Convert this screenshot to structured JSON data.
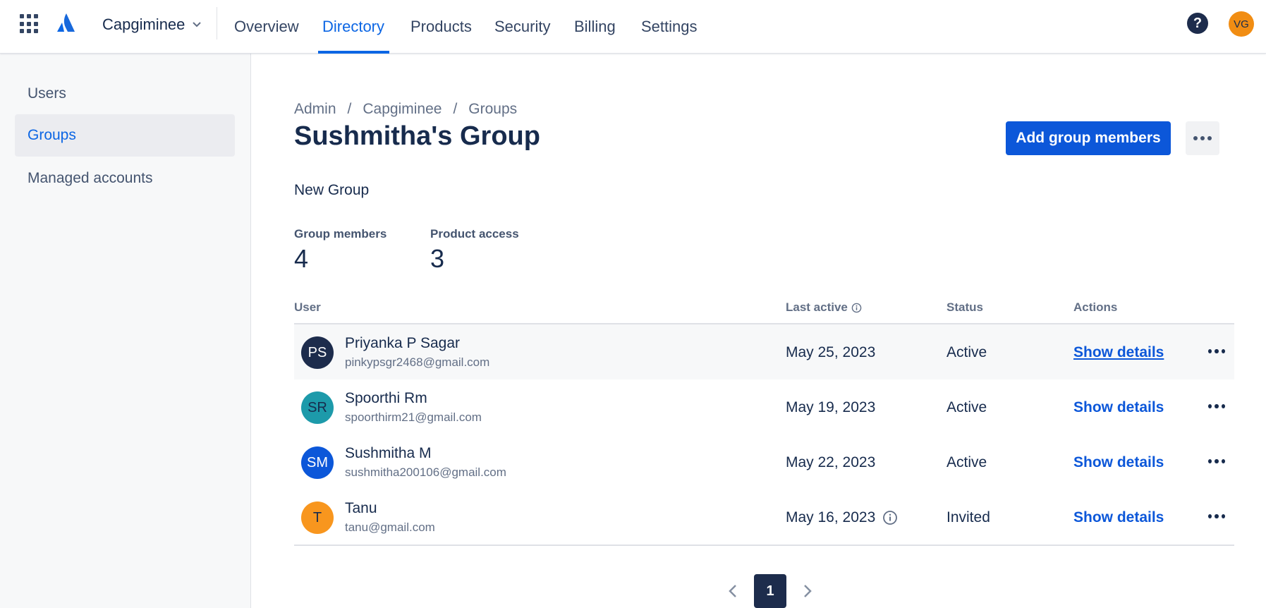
{
  "org": {
    "name": "Capgiminee"
  },
  "nav": {
    "tabs": [
      {
        "label": "Overview"
      },
      {
        "label": "Directory",
        "active": true
      },
      {
        "label": "Products"
      },
      {
        "label": "Security"
      },
      {
        "label": "Billing"
      },
      {
        "label": "Settings"
      }
    ]
  },
  "header_right": {
    "help_label": "?",
    "avatar_initials": "VG",
    "avatar_color": "#f18d13"
  },
  "sidebar": {
    "items": [
      {
        "label": "Users"
      },
      {
        "label": "Groups",
        "active": true
      },
      {
        "label": "Managed accounts"
      }
    ]
  },
  "breadcrumb": [
    "Admin",
    "Capgiminee",
    "Groups"
  ],
  "breadcrumb_separator": "/",
  "page": {
    "title": "Sushmitha's Group",
    "description": "New Group",
    "add_members_label": "Add group members"
  },
  "stats": [
    {
      "label": "Group members",
      "value": "4"
    },
    {
      "label": "Product access",
      "value": "3"
    }
  ],
  "table": {
    "headers": {
      "user": "User",
      "last_active": "Last active",
      "status": "Status",
      "actions": "Actions"
    },
    "rows": [
      {
        "initials": "PS",
        "avatar_color": "#1d2c4c",
        "name": "Priyanka P Sagar",
        "email": "pinkypsgr2468@gmail.com",
        "last_active": "May 25, 2023",
        "status": "Active",
        "action": "Show details"
      },
      {
        "initials": "SR",
        "avatar_color": "#1d9aaa",
        "name": "Spoorthi Rm",
        "email": "spoorthirm21@gmail.com",
        "last_active": "May 19, 2023",
        "status": "Active",
        "action": "Show details"
      },
      {
        "initials": "SM",
        "avatar_color": "#0c57d9",
        "name": "Sushmitha M",
        "email": "sushmitha200106@gmail.com",
        "last_active": "May 22, 2023",
        "status": "Active",
        "action": "Show details"
      },
      {
        "initials": "T",
        "avatar_color": "#f8961e",
        "name": "Tanu",
        "email": "tanu@gmail.com",
        "last_active": "May 16, 2023",
        "status": "Invited",
        "action": "Show details"
      }
    ]
  },
  "pagination": {
    "current_page": "1"
  },
  "colors": {
    "accent": "#0c66e4",
    "primary_button": "#0c57d9",
    "text": "#172b4d"
  }
}
